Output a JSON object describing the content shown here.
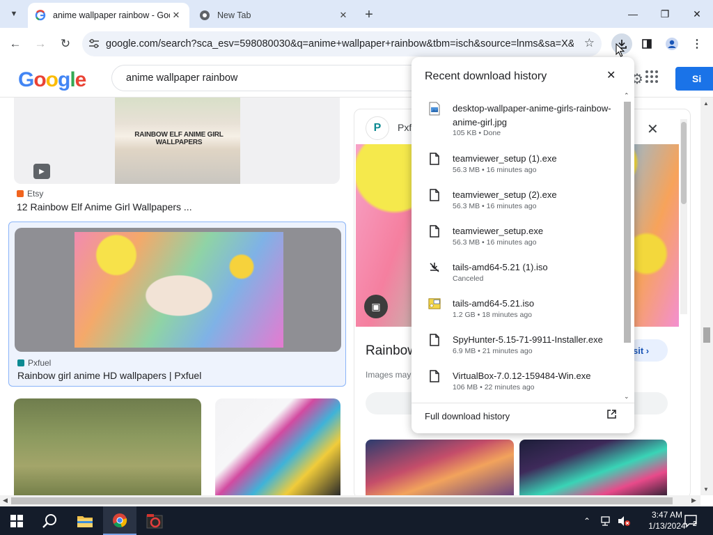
{
  "browser": {
    "tabs": [
      {
        "title": "anime wallpaper rainbow - Goo",
        "active": true
      },
      {
        "title": "New Tab",
        "active": false
      }
    ],
    "url": "google.com/search?sca_esv=598080030&q=anime+wallpaper+rainbow&tbm=isch&source=lnms&sa=X&..."
  },
  "google": {
    "logo": [
      "G",
      "o",
      "o",
      "g",
      "l",
      "e"
    ],
    "query": "anime wallpaper rainbow",
    "signin_label": "Si"
  },
  "results": {
    "card1": {
      "caption": "RAINBOW ELF ANIME GIRL WALLPAPERS",
      "source": "Etsy",
      "title": "12 Rainbow Elf Anime Girl Wallpapers ..."
    },
    "card2": {
      "source": "Pxfuel",
      "title": "Rainbow girl anime HD wallpapers | Pxfuel"
    }
  },
  "side_panel": {
    "source": "Pxfu",
    "title": "Rainbow",
    "subtitle": "Images may",
    "visit_label": "sit"
  },
  "downloads": {
    "heading": "Recent download history",
    "items": [
      {
        "name": "desktop-wallpaper-anime-girls-rainbow-anime-girl.jpg",
        "meta": "105 KB • Done",
        "icon": "image-file-icon"
      },
      {
        "name": "teamviewer_setup (1).exe",
        "meta": "56.3 MB • 16 minutes ago",
        "icon": "file-icon"
      },
      {
        "name": "teamviewer_setup (2).exe",
        "meta": "56.3 MB • 16 minutes ago",
        "icon": "file-icon"
      },
      {
        "name": "teamviewer_setup.exe",
        "meta": "56.3 MB • 16 minutes ago",
        "icon": "file-icon"
      },
      {
        "name": "tails-amd64-5.21 (1).iso",
        "meta": "Canceled",
        "icon": "canceled-download-icon"
      },
      {
        "name": "tails-amd64-5.21.iso",
        "meta": "1.2 GB • 18 minutes ago",
        "icon": "iso-file-icon"
      },
      {
        "name": "SpyHunter-5.15-71-9911-Installer.exe",
        "meta": "6.9 MB • 21 minutes ago",
        "icon": "file-icon"
      },
      {
        "name": "VirtualBox-7.0.12-159484-Win.exe",
        "meta": "106 MB • 22 minutes ago",
        "icon": "file-icon"
      }
    ],
    "full_history_label": "Full download history"
  },
  "taskbar": {
    "time": "3:47 AM",
    "date": "1/13/2024",
    "notification_count": "2"
  },
  "colors": {
    "tabstrip_bg": "#dee8f8",
    "accent_blue": "#1a73e8",
    "taskbar_bg": "#141c2a"
  }
}
